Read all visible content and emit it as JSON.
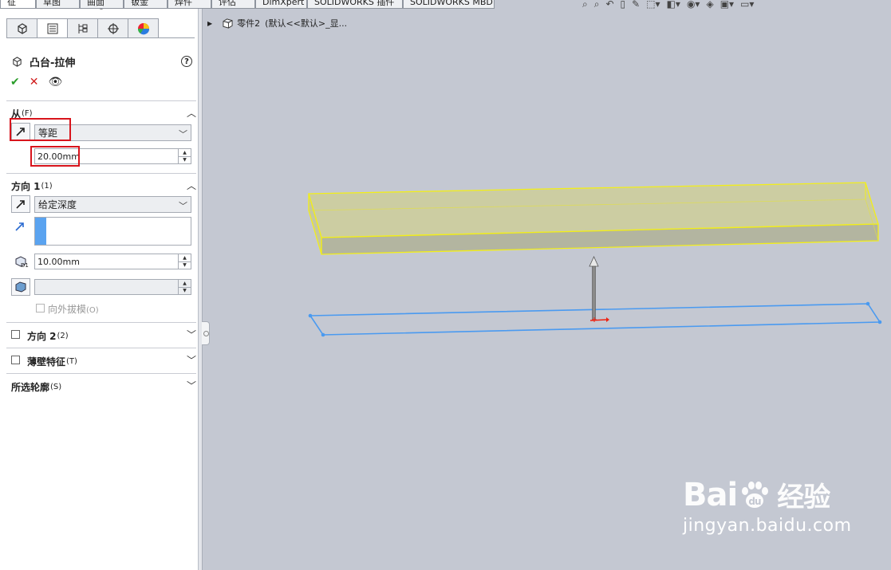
{
  "tabs": [
    "征",
    "草图",
    "曲面",
    "钣金",
    "焊件",
    "评估",
    "DimXpert",
    "SOLIDWORKS 插件",
    "SOLIDWORKS MBD"
  ],
  "property_manager": {
    "panel_tabs": [
      "feature-manager-icon",
      "property-manager-icon",
      "configuration-manager-icon",
      "dimxpert-icon",
      "display-manager-icon"
    ],
    "title": "凸台-拉伸",
    "help": "?",
    "from_section": {
      "label": "从",
      "key": "(F)",
      "start_condition": "等距",
      "offset_value": "20.00mm"
    },
    "direction1_section": {
      "label": "方向 1",
      "key": "(1)",
      "end_condition": "给定深度",
      "depth_value": "10.00mm",
      "draft_value": "",
      "draft_outward_label": "向外拔模",
      "draft_outward_key": "(O)"
    },
    "direction2_section": {
      "label": "方向 2",
      "key": "(2)"
    },
    "thin_feature_section": {
      "label": "薄壁特征",
      "key": "(T)"
    },
    "selected_contours_section": {
      "label": "所选轮廓",
      "key": "(S)"
    }
  },
  "breadcrumb": {
    "part_name": "零件2",
    "config": "(默认<<默认>_显..."
  },
  "watermark": {
    "brand": "Bai",
    "brand_suffix": "du",
    "brand_cn": "经验",
    "url": "jingyan.baidu.com"
  },
  "colors": {
    "accent": "#5aa3f0",
    "highlight_red": "#d8141c",
    "preview_yellow": "#f2ee1a",
    "sketch_blue": "#4a9af0",
    "viewport_bg": "#c4c8d2"
  }
}
